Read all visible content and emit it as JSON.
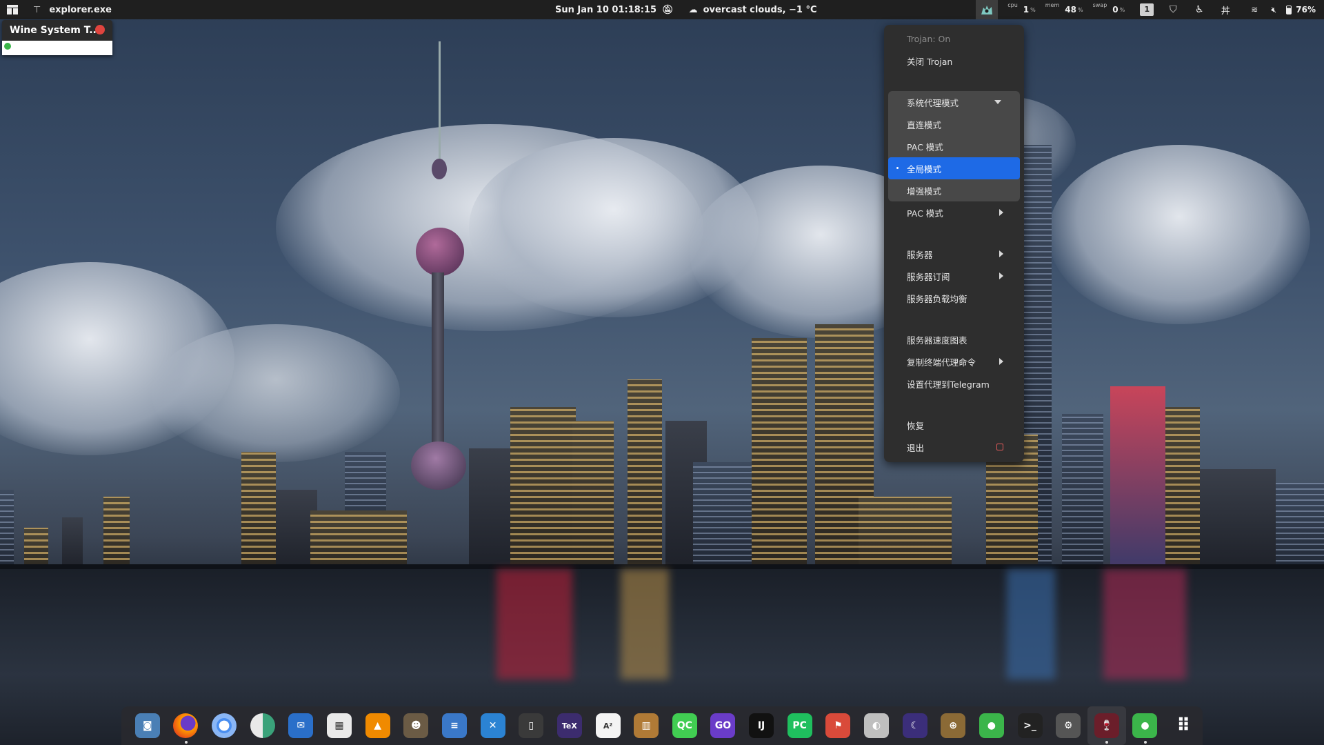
{
  "topbar": {
    "activities_icon": "window-grid-icon",
    "app_icon": "wine-glass-icon",
    "app_name": "explorer.exe",
    "datetime": "Sun Jan 10  01:18:15",
    "weather": "overcast clouds, −1 °C",
    "stats": [
      {
        "label": "cpu",
        "value": "1",
        "unit": "%"
      },
      {
        "label": "mem",
        "value": "48",
        "unit": "%"
      },
      {
        "label": "swap",
        "value": "0",
        "unit": "%"
      }
    ],
    "workspace": "1",
    "battery": "76%"
  },
  "wine_window": {
    "title": "Wine System T..."
  },
  "menu": {
    "status": "Trojan: On",
    "toggle": "关闭 Trojan",
    "proxy_mode": "系统代理模式",
    "direct": "直连模式",
    "pac": "PAC 模式",
    "global": "全局模式",
    "enhanced": "增强模式",
    "pac_submenu": "PAC 模式",
    "servers": "服务器",
    "subscriptions": "服务器订阅",
    "load_balance": "服务器负载均衡",
    "speed_chart": "服务器速度图表",
    "copy_cmd": "复制终端代理命令",
    "telegram": "设置代理到Telegram",
    "restore": "恢复",
    "quit": "退出"
  },
  "dock": {
    "items": [
      {
        "name": "screenshot-icon",
        "glyph": "◙",
        "color": "#4a7fb5",
        "running": false
      },
      {
        "name": "firefox-icon",
        "glyph": "",
        "color": "#e66000",
        "running": true
      },
      {
        "name": "chromium-icon",
        "glyph": "",
        "color": "#4a8ef0",
        "running": false
      },
      {
        "name": "color-picker-icon",
        "glyph": "",
        "color": "#3aa27a",
        "running": false
      },
      {
        "name": "thunderbird-icon",
        "glyph": "✉",
        "color": "#2a6fc9",
        "running": false
      },
      {
        "name": "calendar-icon",
        "glyph": "▦",
        "color": "#e9e9e9",
        "running": false
      },
      {
        "name": "vlc-icon",
        "glyph": "▲",
        "color": "#f08a00",
        "running": false
      },
      {
        "name": "gimp-icon",
        "glyph": "☻",
        "color": "#6b5b45",
        "running": false
      },
      {
        "name": "text-editor-icon",
        "glyph": "≡",
        "color": "#3a78c8",
        "running": false
      },
      {
        "name": "vscode-icon",
        "glyph": "✕",
        "color": "#2b83d3",
        "running": false
      },
      {
        "name": "tablet-icon",
        "glyph": "▯",
        "color": "#3a3a3a",
        "running": false
      },
      {
        "name": "tex-icon",
        "glyph": "TeX",
        "color": "#3c2c6e",
        "running": false
      },
      {
        "name": "math-editor-icon",
        "glyph": "A²",
        "color": "#f4f4f4",
        "running": false
      },
      {
        "name": "books-icon",
        "glyph": "▥",
        "color": "#b07a36",
        "running": false
      },
      {
        "name": "qt-creator-icon",
        "glyph": "QC",
        "color": "#41cd52",
        "running": false
      },
      {
        "name": "goland-icon",
        "glyph": "GO",
        "color": "#6a3cc8",
        "running": false
      },
      {
        "name": "intellij-icon",
        "glyph": "IJ",
        "color": "#111",
        "running": false
      },
      {
        "name": "pycharm-icon",
        "glyph": "PC",
        "color": "#1fbf5e",
        "running": false
      },
      {
        "name": "maps-icon",
        "glyph": "⚑",
        "color": "#d94a3a",
        "running": false
      },
      {
        "name": "disk-pro-icon",
        "glyph": "◐",
        "color": "#bfbfbf",
        "running": false
      },
      {
        "name": "night-sky-icon",
        "glyph": "☾",
        "color": "#3b2e7a",
        "running": false
      },
      {
        "name": "crosshair-icon",
        "glyph": "⊕",
        "color": "#8b6a36",
        "running": false
      },
      {
        "name": "wechat-icon",
        "glyph": "●",
        "color": "#3bb54a",
        "running": false
      },
      {
        "name": "terminal-icon",
        "glyph": ">_",
        "color": "#222",
        "running": false
      },
      {
        "name": "settings-icon",
        "glyph": "⚙",
        "color": "#555",
        "running": false
      },
      {
        "name": "wine-icon",
        "glyph": "🍷",
        "color": "#6b1e2a",
        "running": true
      },
      {
        "name": "wechat-running-icon",
        "glyph": "●",
        "color": "#3bb54a",
        "running": true
      },
      {
        "name": "app-grid-icon",
        "glyph": "⠿",
        "color": "transparent",
        "running": false
      }
    ]
  }
}
